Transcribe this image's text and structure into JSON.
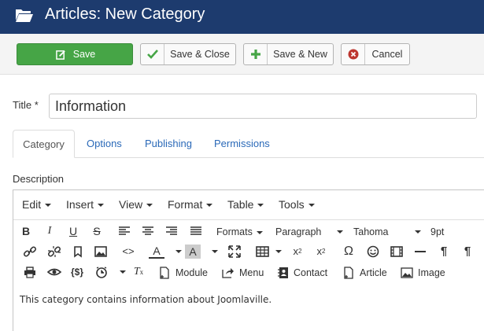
{
  "header": {
    "title": "Articles: New Category",
    "icon": "folder-open-icon"
  },
  "toolbar": {
    "save": "Save",
    "save_close": "Save & Close",
    "save_new": "Save & New",
    "cancel": "Cancel",
    "colors": {
      "save": "#46a546",
      "check": "#46a546",
      "plus": "#46a546",
      "cancel": "#bd362f"
    }
  },
  "form": {
    "title_label": "Title *",
    "title_value": "Information",
    "tabs": [
      "Category",
      "Options",
      "Publishing",
      "Permissions"
    ],
    "description_label": "Description"
  },
  "editor": {
    "menus": [
      "Edit",
      "Insert",
      "View",
      "Format",
      "Table",
      "Tools"
    ],
    "formats": "Formats",
    "block": "Paragraph",
    "font": "Tahoma",
    "size": "9pt",
    "buttons": {
      "module": "Module",
      "menu": "Menu",
      "contact": "Contact",
      "article": "Article",
      "image": "Image"
    },
    "content": "This category contains information about Joomlaville."
  }
}
